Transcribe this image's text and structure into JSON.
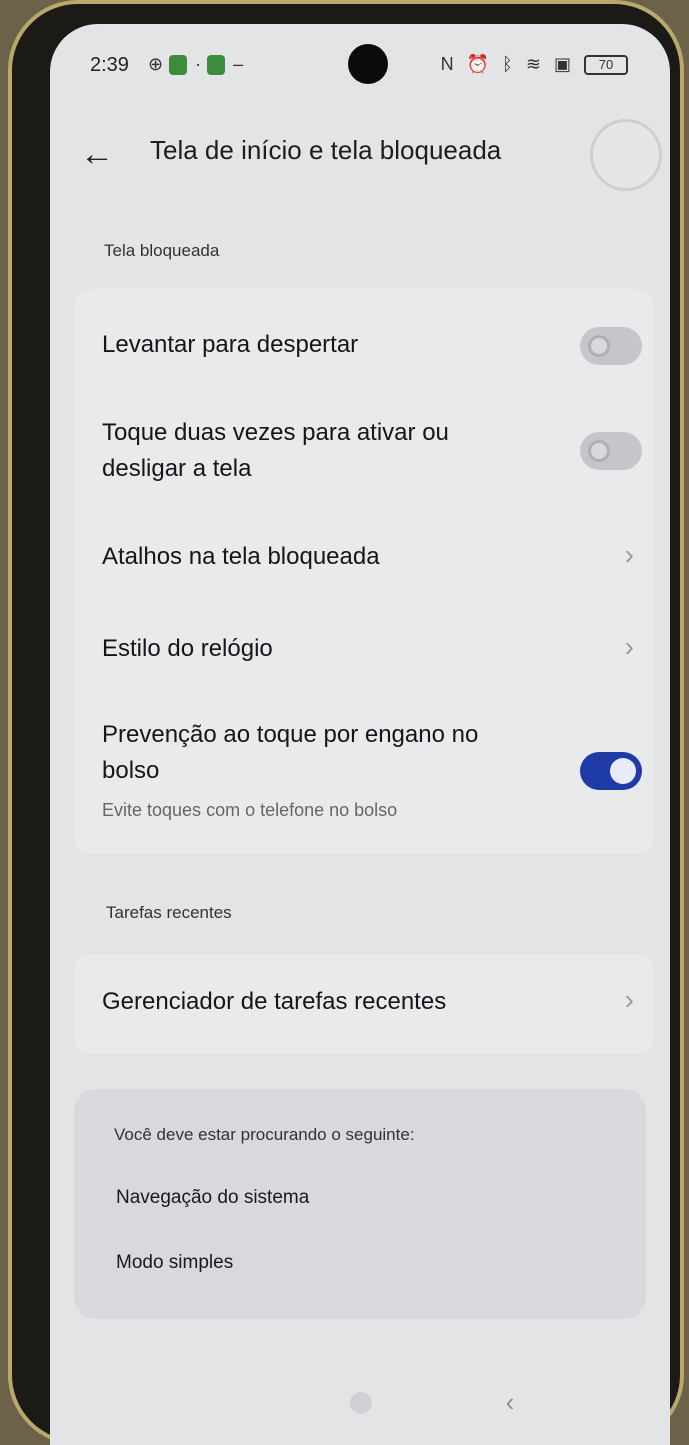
{
  "status_bar": {
    "time": "2:39",
    "battery": "70"
  },
  "header": {
    "back_icon": "arrow-left-icon",
    "title": "Tela de início e tela bloqueada"
  },
  "lock_screen": {
    "section_label": "Tela bloqueada",
    "items": [
      {
        "label": "Levantar para despertar",
        "control": "toggle",
        "on": false
      },
      {
        "label": "Toque duas vezes para ativar ou desligar a tela",
        "control": "toggle",
        "on": false
      },
      {
        "label": "Atalhos na tela bloqueada",
        "control": "chevron"
      },
      {
        "label": "Estilo do relógio",
        "control": "chevron"
      },
      {
        "label": "Prevenção ao toque por engano no bolso",
        "subtitle": "Evite toques com o telefone no bolso",
        "control": "toggle",
        "on": true
      }
    ]
  },
  "recent_tasks": {
    "section_label": "Tarefas recentes",
    "items": [
      {
        "label": "Gerenciador de tarefas recentes",
        "control": "chevron"
      }
    ]
  },
  "suggestions": {
    "header": "Você deve estar procurando o seguinte:",
    "links": [
      "Navegação do sistema",
      "Modo simples"
    ]
  },
  "colors": {
    "toggle_on": "#1f3ba8",
    "toggle_off": "#c5c6ca",
    "screen_bg": "#e3e4e6"
  }
}
